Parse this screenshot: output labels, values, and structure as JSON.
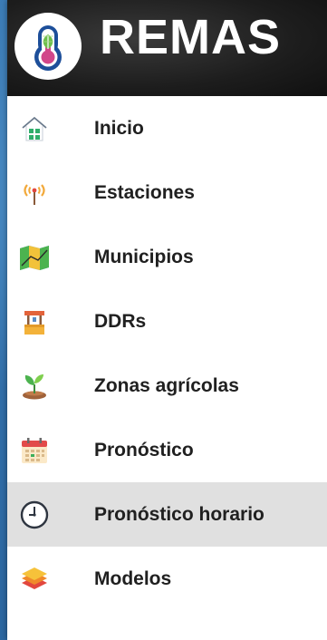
{
  "app": {
    "title": "REMAS",
    "logo_icon": "thermometer-leaf-icon"
  },
  "colors": {
    "header_bg": "#1d1d1d",
    "active_bg": "#e0e0e0",
    "text": "#202020"
  },
  "menu": {
    "active_index": 6,
    "items": [
      {
        "label": "Inicio",
        "icon": "home-icon"
      },
      {
        "label": "Estaciones",
        "icon": "antenna-signal-icon"
      },
      {
        "label": "Municipios",
        "icon": "map-icon"
      },
      {
        "label": "DDRs",
        "icon": "well-icon"
      },
      {
        "label": "Zonas agrícolas",
        "icon": "sprout-icon"
      },
      {
        "label": "Pronóstico",
        "icon": "calendar-icon"
      },
      {
        "label": "Pronóstico horario",
        "icon": "clock-icon"
      },
      {
        "label": "Modelos",
        "icon": "layers-icon"
      }
    ]
  }
}
